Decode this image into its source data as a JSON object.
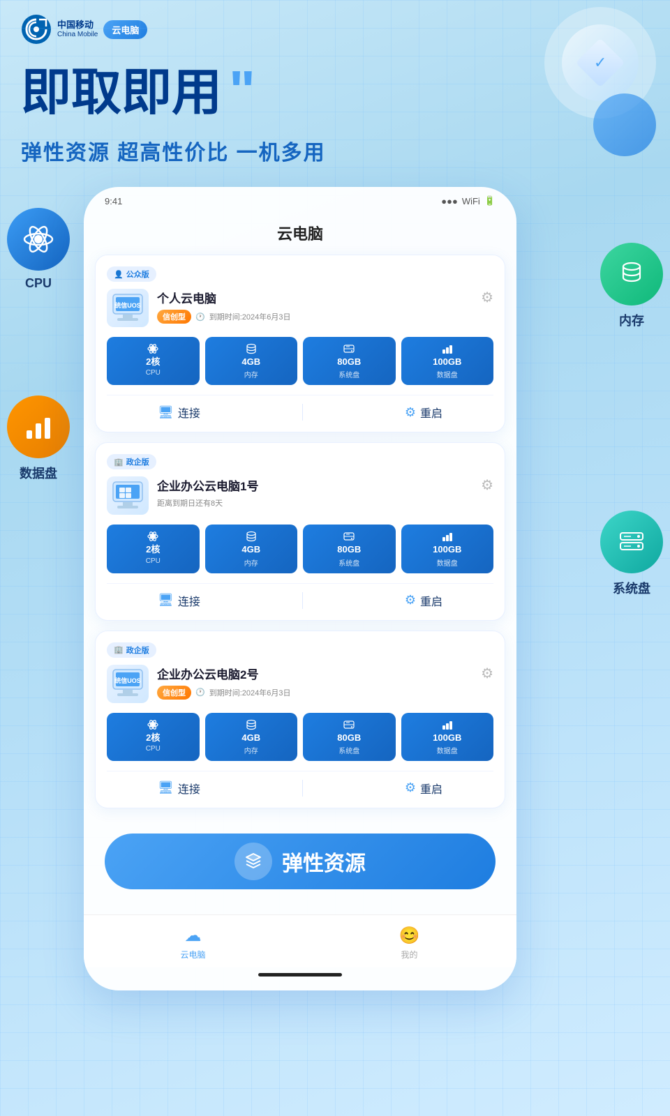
{
  "header": {
    "brand_cn": "中国移动",
    "brand_en": "China Mobile",
    "cloud_label": "云电脑"
  },
  "hero": {
    "title": "即取即用",
    "quote": "\"",
    "subtitle": "弹性资源 超高性价比 一机多用"
  },
  "float_left": [
    {
      "id": "cpu",
      "label": "CPU",
      "type": "blue"
    },
    {
      "id": "data-disk",
      "label": "数据盘",
      "type": "orange"
    }
  ],
  "float_right": [
    {
      "id": "memory",
      "label": "内存",
      "type": "green"
    },
    {
      "id": "system-disk",
      "label": "系统盘",
      "type": "cyan"
    }
  ],
  "phone": {
    "title": "云电脑",
    "cards": [
      {
        "badge": "公众版",
        "badge_type": "public",
        "name": "个人云电脑",
        "tag": "信创型",
        "expire": "到期时间:2024年6月3日",
        "specs": [
          {
            "icon": "atom",
            "value": "2核",
            "label": "CPU"
          },
          {
            "icon": "db",
            "value": "4GB",
            "label": "内存"
          },
          {
            "icon": "hdd",
            "value": "80GB",
            "label": "系统盘"
          },
          {
            "icon": "chart",
            "value": "100GB",
            "label": "数据盘"
          }
        ],
        "actions": [
          "连接",
          "重启"
        ]
      },
      {
        "badge": "政企版",
        "badge_type": "enterprise",
        "name": "企业办公云电脑1号",
        "tag": null,
        "expire": "距离到期日还有8天",
        "specs": [
          {
            "icon": "atom",
            "value": "2核",
            "label": "CPU"
          },
          {
            "icon": "db",
            "value": "4GB",
            "label": "内存"
          },
          {
            "icon": "hdd",
            "value": "80GB",
            "label": "系统盘"
          },
          {
            "icon": "chart",
            "value": "100GB",
            "label": "数据盘"
          }
        ],
        "actions": [
          "连接",
          "重启"
        ]
      },
      {
        "badge": "政企版",
        "badge_type": "enterprise",
        "name": "企业办公云电脑2号",
        "tag": "信创型",
        "expire": "到期时间:2024年6月3日",
        "specs": [
          {
            "icon": "atom",
            "value": "2核",
            "label": "CPU"
          },
          {
            "icon": "db",
            "value": "4GB",
            "label": "内存"
          },
          {
            "icon": "hdd",
            "value": "80GB",
            "label": "系统盘"
          },
          {
            "icon": "chart",
            "value": "100GB",
            "label": "数据盘"
          }
        ],
        "actions": [
          "连接",
          "重启"
        ]
      }
    ],
    "elastic_btn": "弹性资源",
    "nav": [
      {
        "label": "云电脑",
        "active": true
      },
      {
        "label": "我的",
        "active": false
      }
    ]
  }
}
